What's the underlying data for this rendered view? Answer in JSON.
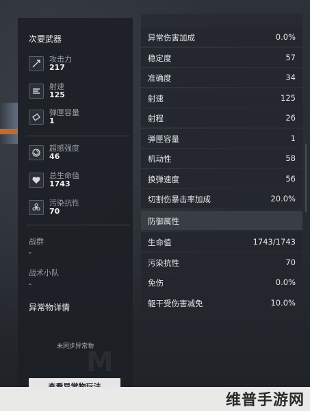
{
  "left": {
    "secondary_weapon_title": "次要武器",
    "stats": [
      {
        "label": "攻击力",
        "value": "217",
        "icon": "attack-icon"
      },
      {
        "label": "射速",
        "value": "125",
        "icon": "firerate-icon"
      },
      {
        "label": "弹匣容量",
        "value": "1",
        "icon": "magazine-icon"
      },
      {
        "label": "超感强度",
        "value": "46",
        "icon": "psi-icon"
      },
      {
        "label": "总生命值",
        "value": "1743",
        "icon": "heart-icon"
      },
      {
        "label": "污染抗性",
        "value": "70",
        "icon": "biohazard-icon"
      }
    ],
    "war_group": {
      "label": "战群",
      "value": "-"
    },
    "tactical_squad": {
      "label": "战术小队",
      "value": "-"
    },
    "anomaly_title": "异常物详情",
    "anomaly_msg": "未同步异常物",
    "view_button": "查看异常物玩法"
  },
  "right": {
    "rows": [
      {
        "label": "异常伤害加成",
        "value": "0.0%"
      },
      {
        "label": "稳定度",
        "value": "57"
      },
      {
        "label": "准确度",
        "value": "34"
      },
      {
        "label": "射速",
        "value": "125"
      },
      {
        "label": "射程",
        "value": "26"
      },
      {
        "label": "弹匣容量",
        "value": "1"
      },
      {
        "label": "机动性",
        "value": "58"
      },
      {
        "label": "换弹速度",
        "value": "56"
      },
      {
        "label": "切割伤暴击率加成",
        "value": "20.0%"
      }
    ],
    "defense_title": "防御属性",
    "defense_rows": [
      {
        "label": "生命值",
        "value": "1743/1743"
      },
      {
        "label": "污染抗性",
        "value": "70"
      },
      {
        "label": "免伤",
        "value": "0.0%"
      },
      {
        "label": "躯干受伤害减免",
        "value": "10.0%"
      }
    ]
  },
  "watermark": "维普手游网"
}
